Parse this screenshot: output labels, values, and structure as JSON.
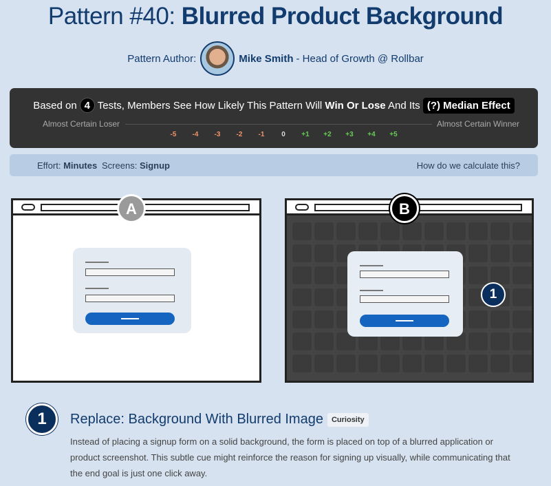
{
  "header": {
    "pattern_prefix": "Pattern #40:",
    "pattern_name": "Blurred Product Background",
    "author_label": "Pattern Author:",
    "author_name": "Mike Smith",
    "author_role": "- Head of Growth @ Rollbar"
  },
  "panel": {
    "based_on": "Based on",
    "tests_count": "4",
    "sentence": "Tests, Members See How Likely This Pattern Will",
    "win_or_lose": "Win Or Lose",
    "and_its": "And Its",
    "median_button": "(?) Median Effect",
    "left_label": "Almost Certain Loser",
    "right_label": "Almost Certain Winner",
    "ticks": [
      "-5",
      "-4",
      "-3",
      "-2",
      "-1",
      "0",
      "+1",
      "+2",
      "+3",
      "+4",
      "+5"
    ],
    "tick_colors": [
      "#f0936a",
      "#f0936a",
      "#f0936a",
      "#f0936a",
      "#f0936a",
      "#dddddd",
      "#66cc55",
      "#66cc55",
      "#66cc55",
      "#66cc55",
      "#66cc55"
    ]
  },
  "effort": {
    "effort_label": "Effort:",
    "effort_value": "Minutes",
    "screens_label": "Screens:",
    "screens_value": "Signup",
    "calc_link": "How do we calculate this?"
  },
  "variants": {
    "a_label": "A",
    "b_label": "B",
    "marker": "1"
  },
  "item": {
    "number": "1",
    "title": "Replace: Background With Blurred Image",
    "tag": "Curiosity",
    "description": "Instead of placing a signup form on a solid background, the form is placed on top of a blurred application or product screenshot. This subtle cue might reinforce the reason for signing up visually, while communicating that the end goal is just one click away."
  },
  "colors": {
    "accent": "#123b6e",
    "button_blue": "#1565c0",
    "panel_bg": "#333333",
    "page_bg": "#d6e2ef"
  }
}
